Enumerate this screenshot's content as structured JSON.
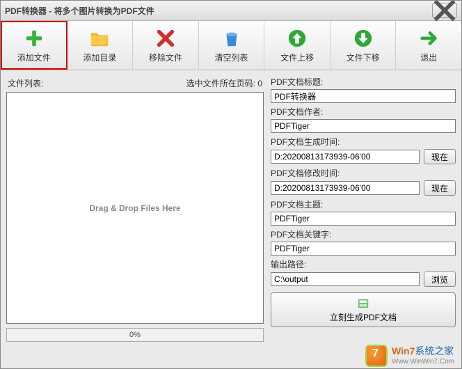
{
  "window": {
    "title": "PDF转换器 - 将多个图片转换为PDF文件"
  },
  "toolbar": {
    "add_file": "添加文件",
    "add_dir": "添加目录",
    "remove": "移除文件",
    "clear": "清空列表",
    "move_up": "文件上移",
    "move_down": "文件下移",
    "exit": "退出"
  },
  "left": {
    "list_label": "文件列表:",
    "page_label": "选中文件所在页码: 0",
    "drop_hint": "Drag & Drop Files Here",
    "progress": "0%"
  },
  "right": {
    "title_label": "PDF文档标题:",
    "title_value": "PDF转换器",
    "author_label": "PDF文档作者:",
    "author_value": "PDFTiger",
    "created_label": "PDF文档生成时间:",
    "created_value": "D:20200813173939-06'00",
    "modified_label": "PDF文档修改时间:",
    "modified_value": "D:20200813173939-06'00",
    "subject_label": "PDF文档主题:",
    "subject_value": "PDFTiger",
    "keywords_label": "PDF文档关键字:",
    "keywords_value": "PDFTiger",
    "output_label": "输出路径:",
    "output_value": "C:\\output",
    "now_btn": "现在",
    "browse_btn": "浏览",
    "generate_btn": "立刻生成PDF文档"
  },
  "watermark": {
    "brand": "Win7",
    "suffix": "系统之家",
    "url": "Www.WinWin7.Com"
  }
}
